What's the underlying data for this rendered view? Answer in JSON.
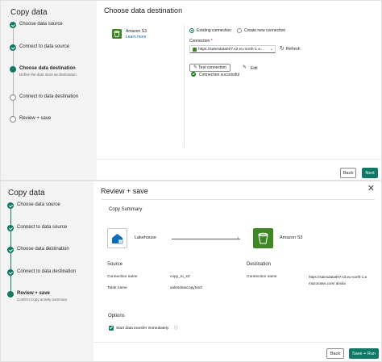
{
  "panel1": {
    "sidebar_title": "Copy data",
    "steps": [
      {
        "label": "Choose data source"
      },
      {
        "label": "Connect to data source"
      },
      {
        "label": "Choose data destination",
        "sub": "Define the data store as destination."
      },
      {
        "label": "Connect to data destination"
      },
      {
        "label": "Review + save"
      }
    ],
    "heading": "Choose data destination",
    "source_card": {
      "name": "Amazon S3",
      "link": "Learn more"
    },
    "options": {
      "existing": "Existing connection",
      "new": "Create new connection"
    },
    "connection": {
      "label": "Connection",
      "required": "*",
      "value": "https://salesdata007.s3.eu-north-1.a...",
      "refresh": "Refresh"
    },
    "test_button": "Test connection",
    "edit_button": "Edit",
    "status": "Connection successful",
    "buttons": {
      "back": "Back",
      "next": "Next"
    }
  },
  "panel2": {
    "sidebar_title": "Copy data",
    "steps": [
      {
        "label": "Choose data source"
      },
      {
        "label": "Connect to data source"
      },
      {
        "label": "Choose data destination"
      },
      {
        "label": "Connect to data destination"
      },
      {
        "label": "Review + save",
        "sub": "Confirm Copy activity summary"
      }
    ],
    "heading": "Review + save",
    "summary_title": "Copy Summary",
    "source_name": "Lakehouse",
    "dest_name": "Amazon S3",
    "source": {
      "title": "Source",
      "rows": [
        {
          "key": "Connection name",
          "value": "copy_to_s3"
        },
        {
          "key": "Table name",
          "value": "salesdatacopytos3"
        }
      ]
    },
    "destination": {
      "title": "Destination",
      "key": "Connection name",
      "value_line1": "https://salesdata007.s3.eu-north-1.a",
      "value_line2": "mazonaws.com/ abiola"
    },
    "options_title": "Options",
    "checkbox_label": "Start data transfer immediately",
    "buttons": {
      "back": "Back",
      "save_run": "Save + Run"
    }
  },
  "colors": {
    "accent": "#117865",
    "sidebar_bg": "#f3f3f3"
  }
}
